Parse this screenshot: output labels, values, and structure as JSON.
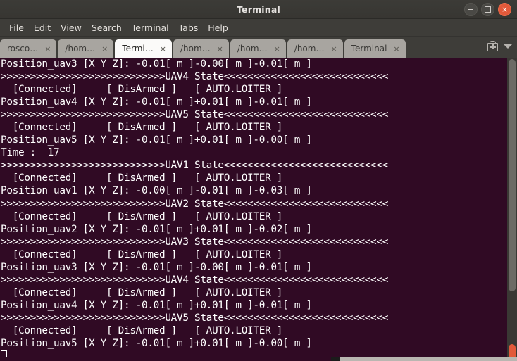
{
  "window": {
    "title": "Terminal",
    "controls": [
      {
        "name": "minimize",
        "glyph": ""
      },
      {
        "name": "maximize",
        "glyph": ""
      },
      {
        "name": "close",
        "glyph": "×"
      }
    ]
  },
  "menubar": {
    "items": [
      "File",
      "Edit",
      "View",
      "Search",
      "Terminal",
      "Tabs",
      "Help"
    ]
  },
  "tabbar": {
    "tabs": [
      {
        "label": "rosco…",
        "close": "×",
        "active": false
      },
      {
        "label": "/hom…",
        "close": "×",
        "active": false
      },
      {
        "label": "Termi…",
        "close": "×",
        "active": true
      },
      {
        "label": "/hom…",
        "close": "×",
        "active": false
      },
      {
        "label": "/hom…",
        "close": "×",
        "active": false
      },
      {
        "label": "/hom…",
        "close": "×",
        "active": false
      },
      {
        "label": "Terminal",
        "close": "×",
        "active": false
      }
    ],
    "new_tab_icon": "new-tab-icon",
    "tab_list_icon": "chevron-down-icon"
  },
  "terminal": {
    "prompt_cursor": "block-cursor",
    "lines": [
      "Position_uav3 [X Y Z]: -0.01[ m ]-0.00[ m ]-0.01[ m ]",
      ">>>>>>>>>>>>>>>>>>>>>>>>>>>>UAV4 State<<<<<<<<<<<<<<<<<<<<<<<<<<<<",
      "  [Connected]     [ DisArmed ]   [ AUTO.LOITER ]",
      "Position_uav4 [X Y Z]: -0.01[ m ]+0.01[ m ]-0.01[ m ]",
      ">>>>>>>>>>>>>>>>>>>>>>>>>>>>UAV5 State<<<<<<<<<<<<<<<<<<<<<<<<<<<<",
      "  [Connected]     [ DisArmed ]   [ AUTO.LOITER ]",
      "Position_uav5 [X Y Z]: -0.01[ m ]+0.01[ m ]-0.00[ m ]",
      "Time :  17",
      ">>>>>>>>>>>>>>>>>>>>>>>>>>>>UAV1 State<<<<<<<<<<<<<<<<<<<<<<<<<<<<",
      "  [Connected]     [ DisArmed ]   [ AUTO.LOITER ]",
      "Position_uav1 [X Y Z]: -0.00[ m ]-0.01[ m ]-0.03[ m ]",
      ">>>>>>>>>>>>>>>>>>>>>>>>>>>>UAV2 State<<<<<<<<<<<<<<<<<<<<<<<<<<<<",
      "  [Connected]     [ DisArmed ]   [ AUTO.LOITER ]",
      "Position_uav2 [X Y Z]: -0.01[ m ]+0.01[ m ]-0.02[ m ]",
      ">>>>>>>>>>>>>>>>>>>>>>>>>>>>UAV3 State<<<<<<<<<<<<<<<<<<<<<<<<<<<<",
      "  [Connected]     [ DisArmed ]   [ AUTO.LOITER ]",
      "Position_uav3 [X Y Z]: -0.01[ m ]-0.00[ m ]-0.01[ m ]",
      ">>>>>>>>>>>>>>>>>>>>>>>>>>>>UAV4 State<<<<<<<<<<<<<<<<<<<<<<<<<<<<",
      "  [Connected]     [ DisArmed ]   [ AUTO.LOITER ]",
      "Position_uav4 [X Y Z]: -0.01[ m ]+0.01[ m ]-0.01[ m ]",
      ">>>>>>>>>>>>>>>>>>>>>>>>>>>>UAV5 State<<<<<<<<<<<<<<<<<<<<<<<<<<<<",
      "  [Connected]     [ DisArmed ]   [ AUTO.LOITER ]",
      "Position_uav5 [X Y Z]: -0.01[ m ]+0.01[ m ]-0.00[ m ]"
    ]
  },
  "colors": {
    "terminal_background": "#300a24",
    "terminal_foreground": "#ffffff",
    "titlebar": "#3c3b37",
    "close_button": "#e2593a",
    "active_tab": "#fbfaf9",
    "inactive_tab": "#a8a5a0"
  }
}
